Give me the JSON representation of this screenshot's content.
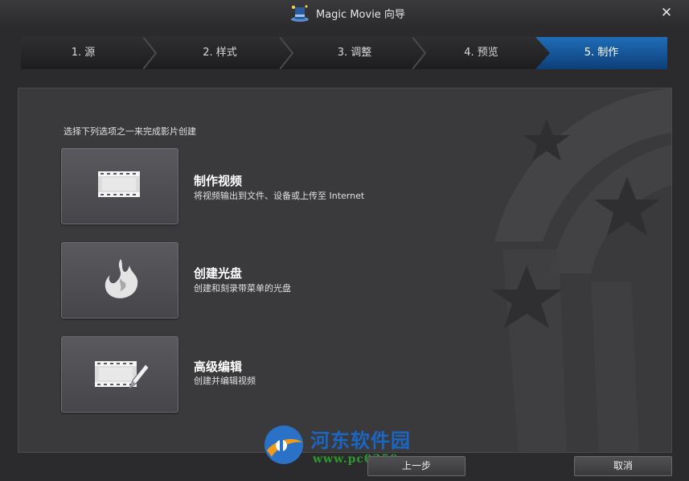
{
  "window": {
    "title": "Magic Movie 向导",
    "close_label": "✕"
  },
  "steps": [
    {
      "label": "1. 源"
    },
    {
      "label": "2. 样式"
    },
    {
      "label": "3. 调整"
    },
    {
      "label": "4. 预览"
    },
    {
      "label": "5. 制作",
      "active": true
    }
  ],
  "main": {
    "instruction": "选择下列选项之一来完成影片创建",
    "options": [
      {
        "title": "制作视频",
        "description": "将视频输出到文件、设备或上传至 Internet",
        "icon": "film-icon"
      },
      {
        "title": "创建光盘",
        "description": "创建和刻录带菜单的光盘",
        "icon": "flame-icon"
      },
      {
        "title": "高级编辑",
        "description": "创建并编辑视频",
        "icon": "film-edit-icon"
      }
    ]
  },
  "footer": {
    "back_label": "上一步",
    "cancel_label": "取消"
  },
  "watermark": {
    "name": "河东软件园",
    "url": "www.pc0359.cn"
  },
  "colors": {
    "accent": "#1a6bb8",
    "background": "#2b2b2d",
    "panel": "#3a3a3c"
  }
}
